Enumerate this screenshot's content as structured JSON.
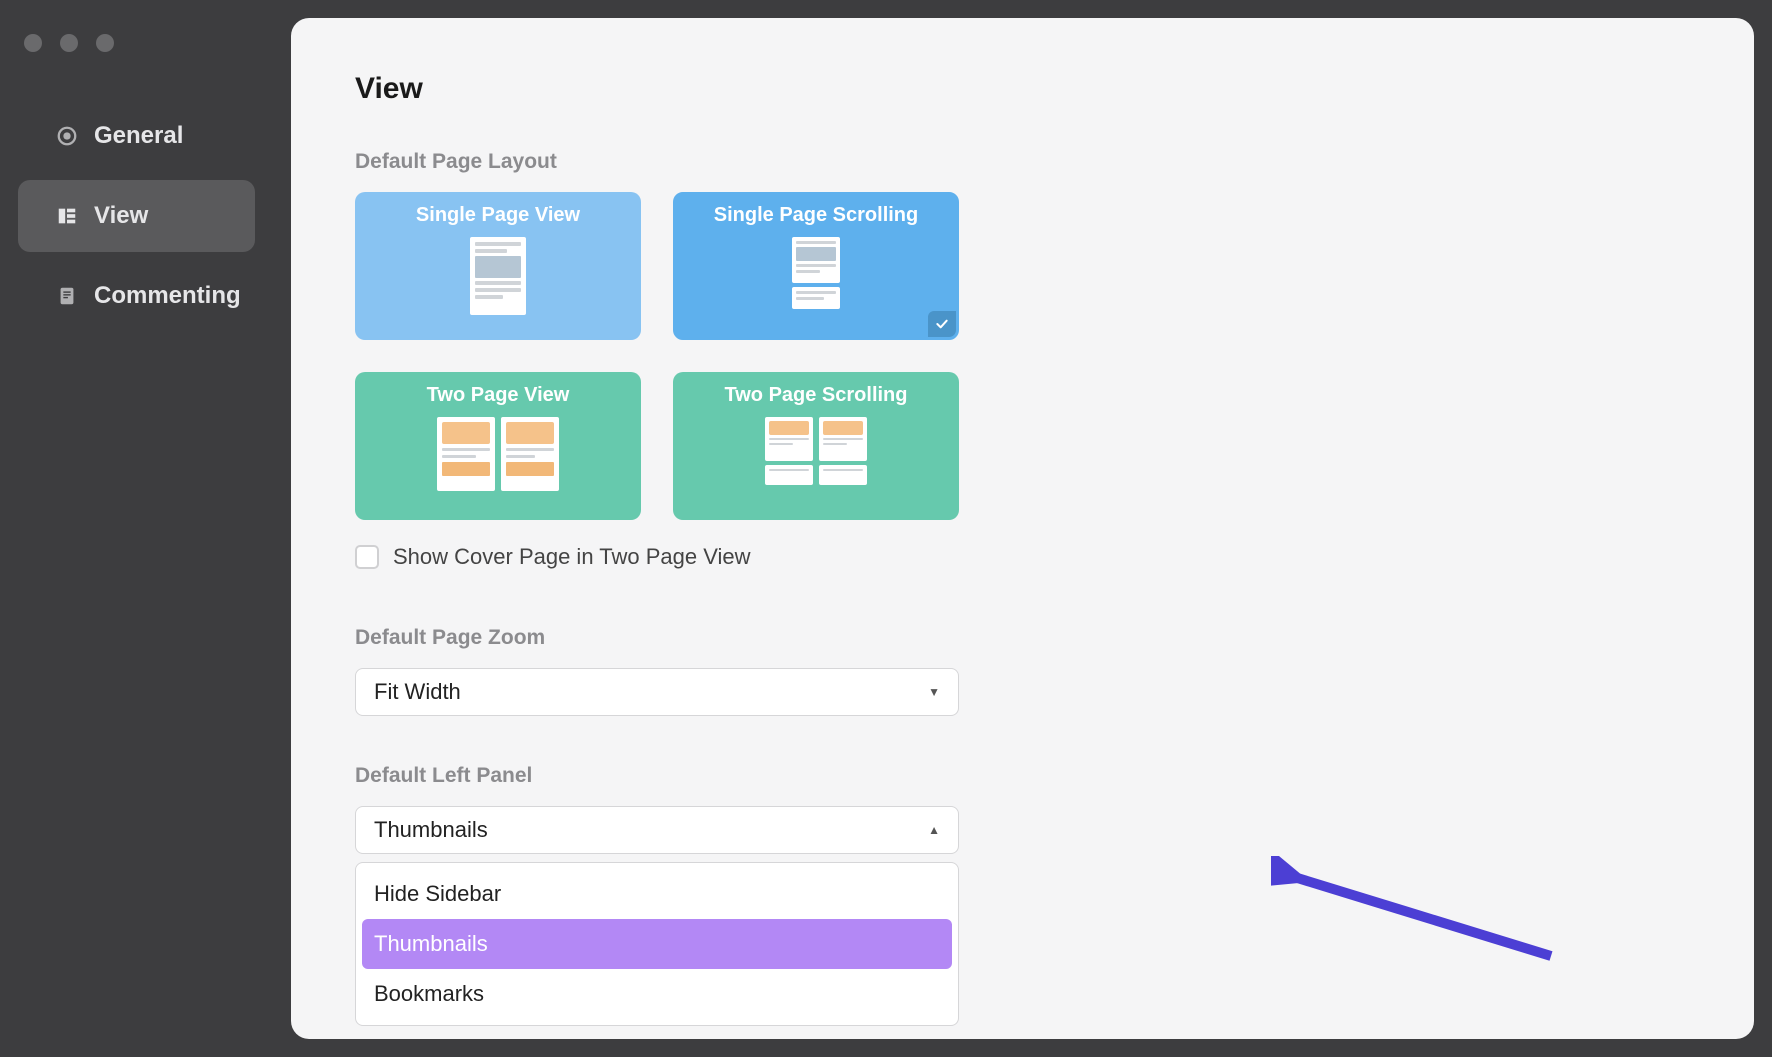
{
  "sidebar": {
    "items": [
      {
        "label": "General"
      },
      {
        "label": "View"
      },
      {
        "label": "Commenting"
      }
    ]
  },
  "page": {
    "title": "View"
  },
  "layout": {
    "section_label": "Default Page Layout",
    "options": {
      "single_page_view": "Single Page View",
      "single_page_scroll": "Single Page Scrolling",
      "two_page_view": "Two Page View",
      "two_page_scroll": "Two Page Scrolling"
    },
    "cover_page_label": "Show Cover Page in Two Page View"
  },
  "zoom": {
    "section_label": "Default Page Zoom",
    "selected": "Fit Width"
  },
  "left_panel": {
    "section_label": "Default Left Panel",
    "selected": "Thumbnails",
    "options": {
      "hide": "Hide Sidebar",
      "thumbs": "Thumbnails",
      "bookmarks": "Bookmarks"
    }
  }
}
